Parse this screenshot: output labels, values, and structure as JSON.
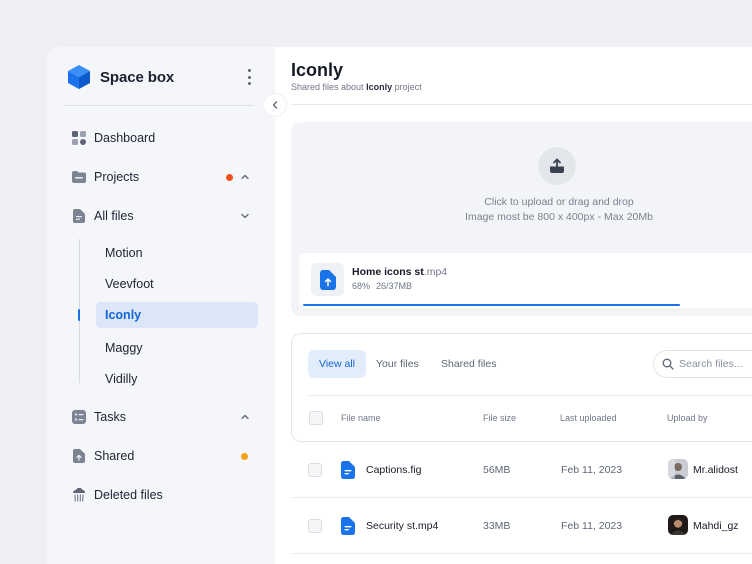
{
  "sidebar": {
    "brand": "Space box",
    "items": [
      {
        "label": "Dashboard",
        "icon": "dashboard-icon"
      },
      {
        "label": "Projects",
        "icon": "folder-icon",
        "dot_color": "#f0511c"
      },
      {
        "label": "All files",
        "icon": "document-icon"
      },
      {
        "label": "Tasks",
        "icon": "tasks-icon"
      },
      {
        "label": "Shared",
        "icon": "share-icon",
        "dot_color": "#f5a21b"
      },
      {
        "label": "Deleted files",
        "icon": "trash-icon"
      }
    ],
    "subitems": [
      "Motion",
      "Veevfoot",
      "Iconly",
      "Maggy",
      "Vidilly"
    ],
    "active_subitem": "Iconly"
  },
  "header": {
    "title": "Iconly",
    "subtitle_prefix": "Shared files about ",
    "subtitle_project": "Iconly",
    "subtitle_suffix": " project"
  },
  "upload": {
    "line1": "Click to upload or  drag and drop",
    "line2": "Image most be 800 x 400px - Max 20Mb",
    "file_name": "Home icons st",
    "file_ext": ".mp4",
    "percent_label": "68%",
    "size_progress": "26/37MB",
    "progress": 0.84
  },
  "files": {
    "tabs": [
      "View all",
      "Your files",
      "Shared files"
    ],
    "active_tab": "View all",
    "search_placeholder": "Search files...",
    "columns": {
      "name": "File name",
      "size": "File size",
      "date": "Last uploaded",
      "user": "Upload by"
    },
    "rows": [
      {
        "name": "Captions.fig",
        "size": "56MB",
        "date": "Feb 11, 2023",
        "user": "Mr.alidost"
      },
      {
        "name": "Security st.mp4",
        "size": "33MB",
        "date": "Feb 11, 2023",
        "user": "Mahdi_gz"
      }
    ]
  },
  "colors": {
    "accent": "#1a73e8",
    "active_bg": "#dbe7f8"
  }
}
